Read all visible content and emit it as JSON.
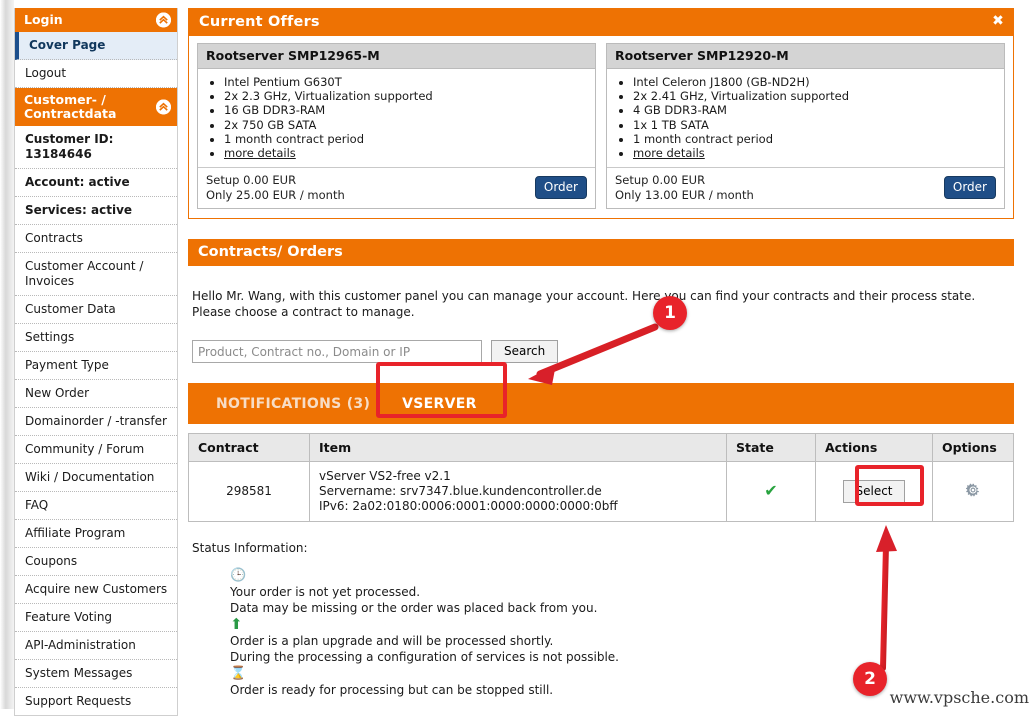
{
  "sidebar": {
    "groups": [
      {
        "header": "Login",
        "collapse_icon": "chevrons-up-icon",
        "items": [
          {
            "label": "Cover Page",
            "active": true
          },
          {
            "label": "Logout",
            "active": false
          }
        ]
      },
      {
        "header": "Customer- / Contractdata",
        "collapse_icon": "chevrons-up-icon",
        "items": [
          {
            "label": "Customer ID: 13184646",
            "info": true
          },
          {
            "label": "Account: active",
            "info": true
          },
          {
            "label": "Services: active",
            "info": true
          },
          {
            "label": "Contracts"
          },
          {
            "label": "Customer Account / Invoices"
          },
          {
            "label": "Customer Data"
          },
          {
            "label": "Settings"
          },
          {
            "label": "Payment Type"
          },
          {
            "label": "New Order"
          },
          {
            "label": "Domainorder / -transfer"
          },
          {
            "label": "Community / Forum"
          },
          {
            "label": "Wiki / Documentation"
          },
          {
            "label": "FAQ"
          },
          {
            "label": "Affiliate Program"
          },
          {
            "label": "Coupons"
          },
          {
            "label": "Acquire new Customers"
          },
          {
            "label": "Feature Voting"
          },
          {
            "label": "API-Administration"
          },
          {
            "label": "System Messages"
          },
          {
            "label": "Support Requests"
          }
        ]
      }
    ]
  },
  "offers": {
    "title": "Current Offers",
    "close_icon": "close-icon",
    "cards": [
      {
        "title": "Rootserver SMP12965-M",
        "specs": [
          "Intel Pentium G630T",
          "2x 2.3 GHz, Virtualization supported",
          "16 GB DDR3-RAM",
          "2x 750 GB SATA",
          "1 month contract period"
        ],
        "more_details": "more details",
        "setup": "Setup 0.00 EUR",
        "price": "Only 25.00 EUR / month",
        "order_label": "Order"
      },
      {
        "title": "Rootserver SMP12920-M",
        "specs": [
          "Intel Celeron J1800 (GB-ND2H)",
          "2x 2.41 GHz, Virtualization supported",
          "4 GB DDR3-RAM",
          "1x 1 TB SATA",
          "1 month contract period"
        ],
        "more_details": "more details",
        "setup": "Setup 0.00 EUR",
        "price": "Only 13.00 EUR / month",
        "order_label": "Order"
      }
    ]
  },
  "contracts": {
    "title": "Contracts/ Orders",
    "intro_line1": "Hello Mr. Wang, with this customer panel you can manage your account. Here you can find your contracts and their process state.",
    "intro_line2": "Please choose a contract to manage.",
    "search": {
      "placeholder": "Product, Contract no., Domain or IP",
      "value": "",
      "button_label": "Search"
    },
    "tabs": [
      {
        "label": "NOTIFICATIONS (3)",
        "active": false
      },
      {
        "label": "VSERVER",
        "active": true
      }
    ],
    "table": {
      "headers": [
        "Contract",
        "Item",
        "State",
        "Actions",
        "Options"
      ],
      "rows": [
        {
          "contract": "298581",
          "item_line1": "vServer VS2-free v2.1",
          "item_line2": "Servername: srv7347.blue.kundencontroller.de",
          "item_line3": "IPv6: 2a02:0180:0006:0001:0000:0000:0000:0bff",
          "state_icon": "green-check-icon",
          "action_label": "Select",
          "options_icon": "gear-icon"
        }
      ]
    }
  },
  "status": {
    "title": "Status Information:",
    "entries": [
      {
        "icon": "clock-icon",
        "line1": "Your order is not yet processed.",
        "line2": "Data may be missing or the order was placed back from you."
      },
      {
        "icon": "green-up-arrow-icon",
        "line1": "Order is a plan upgrade and will be processed shortly.",
        "line2": "During the processing a configuration of services is not possible."
      },
      {
        "icon": "hourglass-icon",
        "line1": "Order is ready for processing but can be stopped still.",
        "line2": ""
      }
    ]
  },
  "annotations": {
    "badge1": "1",
    "badge2": "2",
    "watermark": "www.vpsche.com"
  },
  "colors": {
    "brand_orange": "#ee7203",
    "annotation_red": "#e8232a",
    "order_blue": "#1f4e87",
    "state_green": "#28a33f"
  }
}
